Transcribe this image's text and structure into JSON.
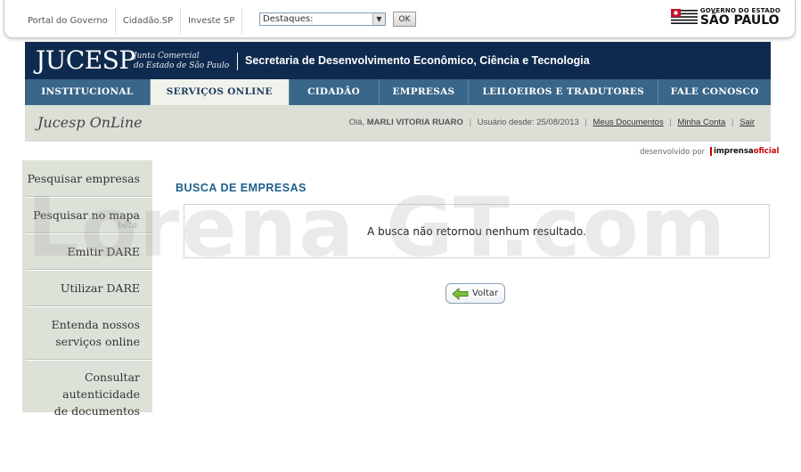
{
  "gov_bar": {
    "links": [
      "Portal do Governo",
      "Cidadão.SP",
      "Investe SP"
    ],
    "select_value": "Destaques:",
    "ok_label": "OK",
    "logo_line1": "GOVERNO DO ESTADO",
    "logo_line2": "SÃO PAULO"
  },
  "header": {
    "brand": "JUCESP",
    "brand_sub1": "Junta Comercial",
    "brand_sub2": "do Estado de São Paulo",
    "title": "Secretaria de Desenvolvimento Econômico, Ciência e Tecnologia"
  },
  "nav": {
    "items": [
      "INSTITUCIONAL",
      "SERVIÇOS ONLINE",
      "CIDADÃO",
      "EMPRESAS",
      "LEILOEIROS E TRADUTORES",
      "FALE CONOSCO"
    ],
    "active": "SERVIÇOS ONLINE"
  },
  "subheader": {
    "title": "Jucesp OnLine",
    "greeting": "Olá,",
    "user_name": "MARLI VITORIA RUARO",
    "since": "Usuário desde: 25/08/2013",
    "link_docs": "Meus Documentos",
    "link_account": "Minha Conta",
    "link_exit": "Sair"
  },
  "developed_by": "desenvolvido por",
  "developer_brand1": "imprensa",
  "developer_brand2": "oficial",
  "sidebar": {
    "items": [
      {
        "line1": "Pesquisar empresas",
        "line2": ""
      },
      {
        "line1": "Pesquisar no mapa",
        "line2": ""
      },
      {
        "line1": "Emitir DARE",
        "line2": ""
      },
      {
        "line1": "Utilizar DARE",
        "line2": ""
      },
      {
        "line1": "Entenda nossos",
        "line2": "serviços online"
      },
      {
        "line1": "Consultar autenticidade",
        "line2": "de documentos"
      }
    ],
    "beta": "beta"
  },
  "main": {
    "title": "BUSCA DE EMPRESAS",
    "message": "A busca não retornou nenhum resultado.",
    "back_label": "Voltar"
  },
  "watermark": "Lorena GT.com",
  "colors": {
    "header_bg": "#0e2a4e",
    "nav_bg": "#3a6689",
    "title_blue": "#1e5f8c",
    "sidebar_bg": "#dde2d9"
  }
}
